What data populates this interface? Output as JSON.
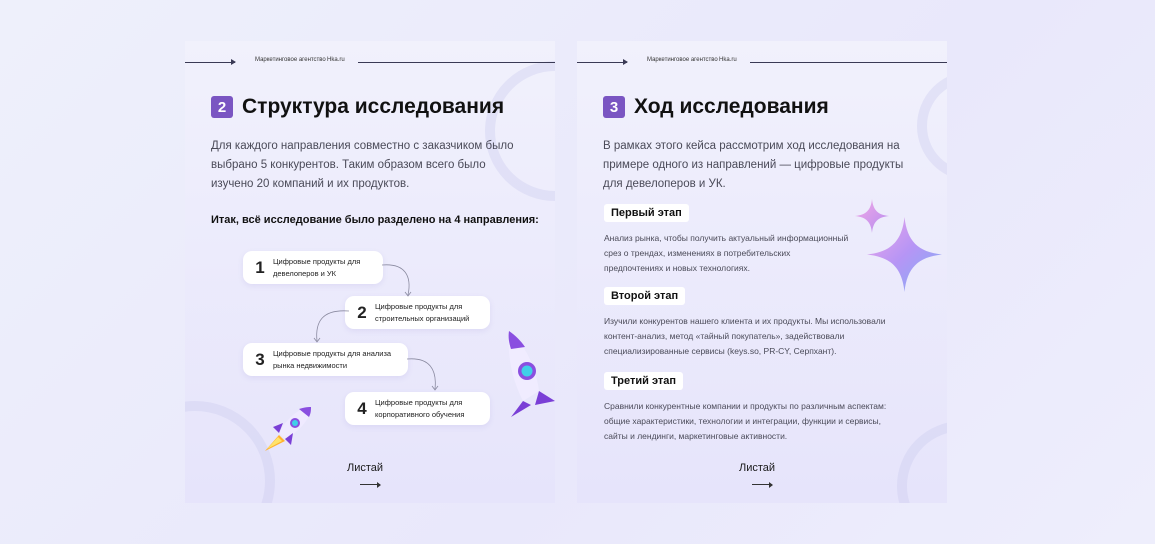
{
  "brand": {
    "agency": "Маркетинговое агентство",
    "site": "Hka.ru"
  },
  "left_card": {
    "number": "2",
    "title": "Структура исследования",
    "intro": [
      "Для каждого направления совместно с заказчиком было",
      "выбрано 5 конкурентов. Таким образом всего было",
      "изучено 20 компаний и их продуктов."
    ],
    "subheading": "Итак, всё исследование было разделено на 4 направления:",
    "directions": [
      {
        "num": "1",
        "lines": [
          "Цифровые продукты для",
          "девелоперов и УК"
        ]
      },
      {
        "num": "2",
        "lines": [
          "Цифровые продукты для",
          "строительных организаций"
        ]
      },
      {
        "num": "3",
        "lines": [
          "Цифровые продукты для анализа",
          "рынка недвижимости"
        ]
      },
      {
        "num": "4",
        "lines": [
          "Цифровые продукты для",
          "корпоративного обучения"
        ]
      }
    ],
    "swipe": "Листай"
  },
  "right_card": {
    "number": "3",
    "title": "Ход исследования",
    "intro": [
      "В рамках этого кейса рассмотрим ход исследования на",
      "примере одного из направлений — цифровые продукты",
      "для девелоперов и УК."
    ],
    "stages": [
      {
        "label": "Первый этап",
        "lines": [
          "Анализ рынка, чтобы получить актуальный информационный",
          "срез о трендах, изменениях в потребительских",
          "предпочтениях и новых технологиях."
        ]
      },
      {
        "label": "Второй этап",
        "lines": [
          "Изучили конкурентов нашего клиента и их продукты. Мы использовали",
          "контент-анализ, метод «тайный покупатель», задействовали",
          "специализированные сервисы (keys.so, PR-CY, Серпхант)."
        ]
      },
      {
        "label": "Третий этап",
        "lines": [
          "Сравнили конкурентные компании и продукты по различным аспектам:",
          "общие характеристики, технологии и интеграции, функции и сервисы,",
          "сайты и лендинги, маркетинговые активности."
        ]
      }
    ],
    "swipe": "Листай"
  },
  "colors": {
    "badge": "#7a55c2",
    "card_top": "#f1f1fc",
    "card_bottom": "#e6e4fb",
    "pill": "#ffffff"
  }
}
